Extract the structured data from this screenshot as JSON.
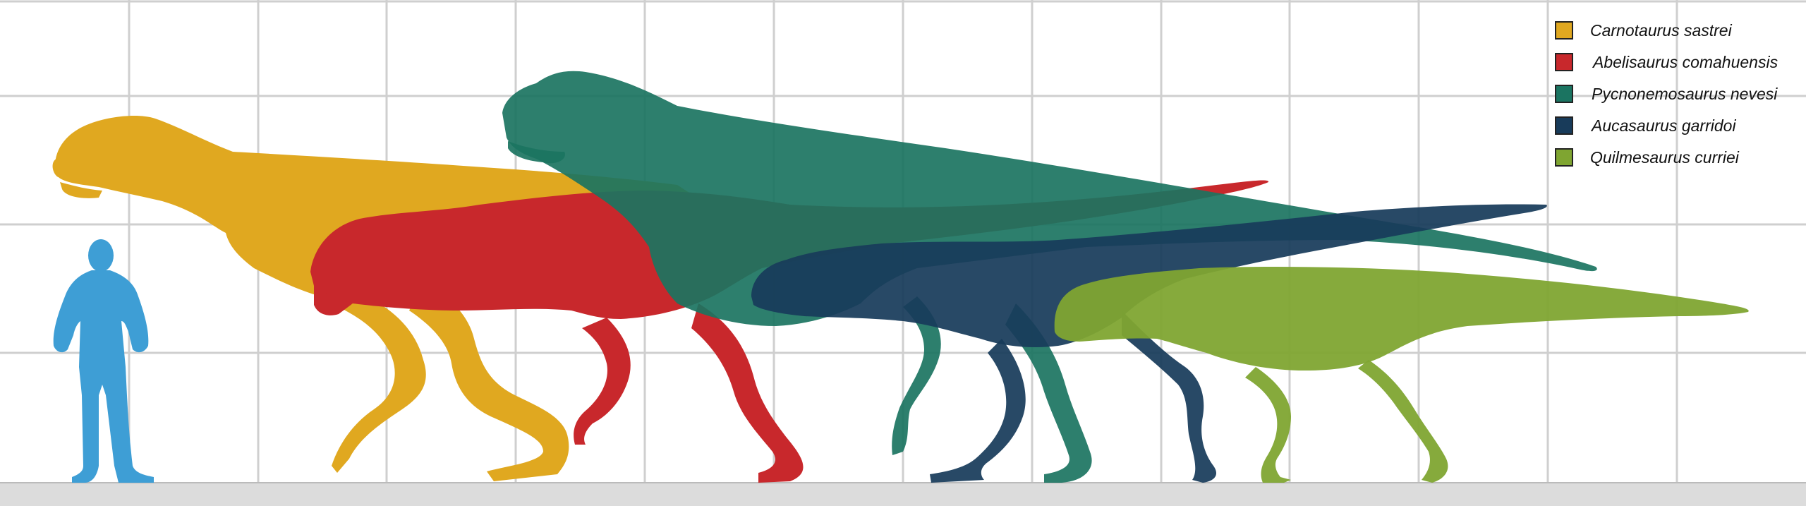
{
  "colors": {
    "grid": "#cfcfcf",
    "ground": "#dcdcdc",
    "human": "#3e9ed5"
  },
  "legend": [
    {
      "label": "Carnotaurus sastrei",
      "color": "#e0a820"
    },
    {
      "label": "Abelisaurus comahuensis",
      "color": "#c8282c"
    },
    {
      "label": "Pycnonemosaurus nevesi",
      "color": "#1b7461"
    },
    {
      "label": "Aucasaurus garridoi",
      "color": "#183b5a"
    },
    {
      "label": "Quilmesaurus curriei",
      "color": "#7fa531"
    }
  ]
}
